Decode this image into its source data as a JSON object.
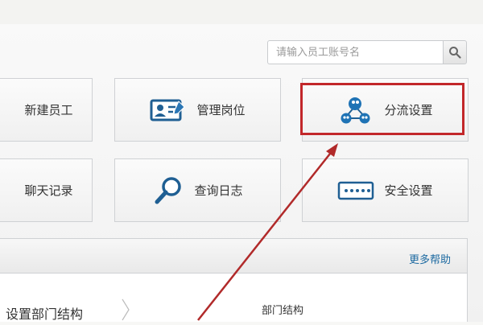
{
  "search": {
    "placeholder": "请输入员工账号名"
  },
  "tiles": [
    {
      "label": "新建员工"
    },
    {
      "label": "管理岗位"
    },
    {
      "label": "分流设置"
    },
    {
      "label": "聊天记录"
    },
    {
      "label": "查询日志"
    },
    {
      "label": "安全设置"
    }
  ],
  "help": {
    "more_label": "更多帮助"
  },
  "panel": {
    "left_item": "设置部门结构",
    "right_title": "部门结构"
  },
  "icons": {
    "search": "search-icon",
    "manage_position": "id-card-edit-icon",
    "distribution": "group-nodes-icon",
    "query_log": "magnifier-icon",
    "security": "password-field-icon",
    "chevron": "chevron-right-icon"
  },
  "colors": {
    "accent_blue": "#1d6aa1",
    "highlight_red": "#c2272a",
    "arrow_red": "#b12a2a"
  }
}
